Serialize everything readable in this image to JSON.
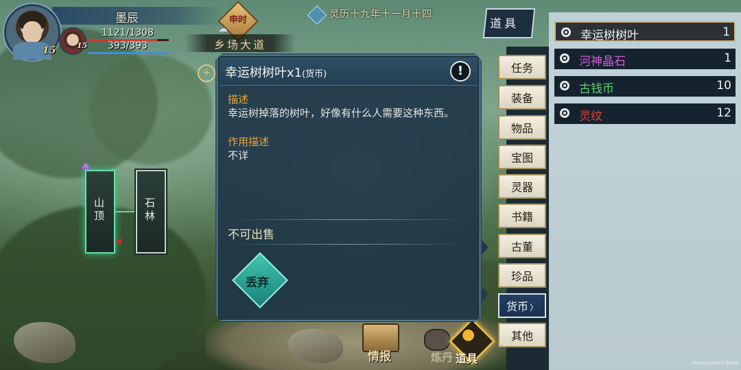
{
  "player": {
    "name": "墨辰",
    "level": "15",
    "hp": "1121/1308",
    "hp_fraction": 0.857,
    "mp": "393/393",
    "mp_fraction": 1.0,
    "pet_level": "15"
  },
  "time_badge": "申时",
  "location": "乡场大道",
  "date": "灵历十九年十一月十四",
  "map_nodes": [
    {
      "label": "山顶",
      "active": true
    },
    {
      "label": "石林",
      "active": false
    }
  ],
  "popup": {
    "title": "幸运树树叶x1",
    "title_tag": "(货币)",
    "desc_label": "描述",
    "desc_text": "幸运树掉落的树叶，好像有什么人需要这种东西。",
    "effect_label": "作用描述",
    "effect_text": "不详",
    "not_sellable": "不可出售",
    "discard_label": "丢弃"
  },
  "bottom_bar": {
    "info_label": "情报",
    "craft_label": "炼丹",
    "items_label": "道具"
  },
  "panel_title": "道具",
  "side_tabs": [
    "任务",
    "装备",
    "物品",
    "宝图",
    "灵器",
    "书籍",
    "古董",
    "珍品",
    "货币",
    "其他"
  ],
  "active_tab": "货币",
  "items": [
    {
      "name": "幸运树树叶",
      "count": "1",
      "color": "#f2f2f2",
      "selected": true
    },
    {
      "name": "河神晶石",
      "count": "1",
      "color": "#d35bd8",
      "selected": false
    },
    {
      "name": "古钱币",
      "count": "10",
      "color": "#5fd36a",
      "selected": false
    },
    {
      "name": "灵纹",
      "count": "12",
      "color": "#e0413e",
      "selected": false
    }
  ],
  "dev_build": "Development Build"
}
